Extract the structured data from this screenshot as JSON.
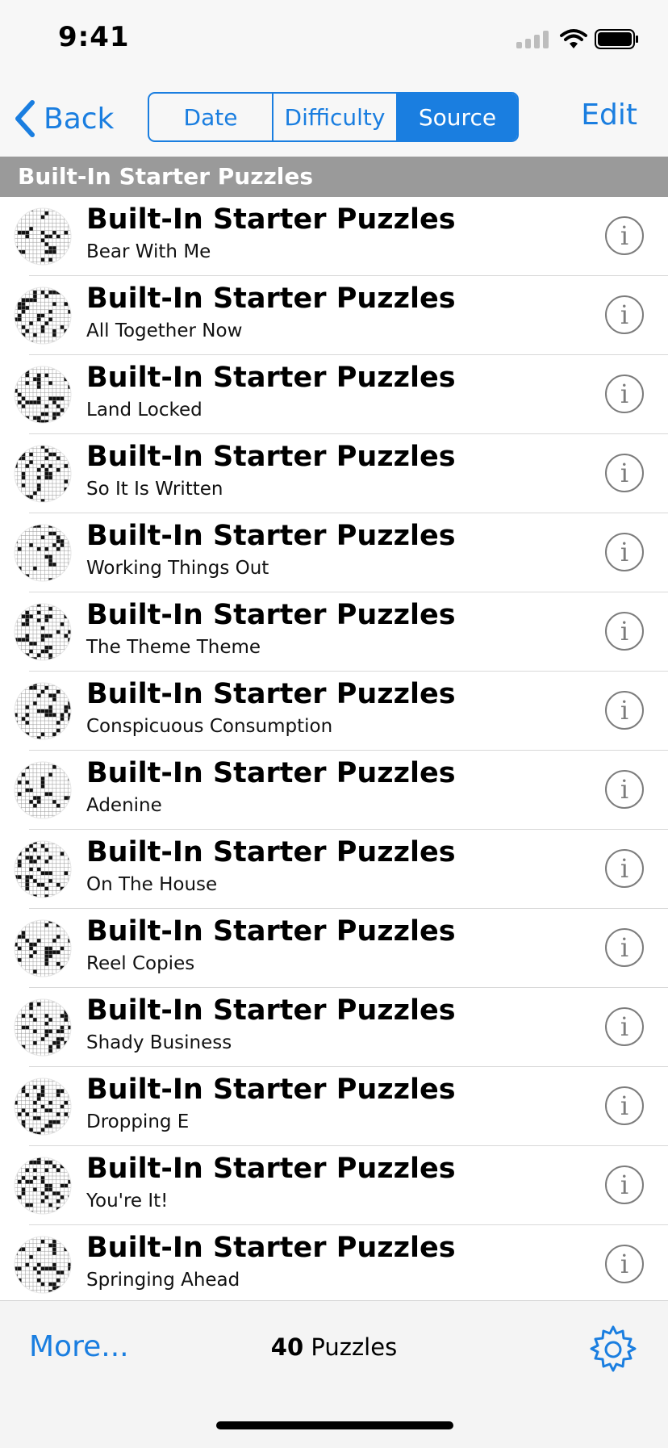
{
  "status_bar": {
    "time": "9:41"
  },
  "nav": {
    "back_label": "Back",
    "segments": [
      {
        "label": "Date",
        "selected": false
      },
      {
        "label": "Difficulty",
        "selected": false
      },
      {
        "label": "Source",
        "selected": true
      }
    ],
    "edit_label": "Edit"
  },
  "section": {
    "title": "Built-In Starter Puzzles"
  },
  "puzzles": [
    {
      "title": "Built-In Starter Puzzles",
      "subtitle": "Bear With Me"
    },
    {
      "title": "Built-In Starter Puzzles",
      "subtitle": "All Together Now"
    },
    {
      "title": "Built-In Starter Puzzles",
      "subtitle": "Land Locked"
    },
    {
      "title": "Built-In Starter Puzzles",
      "subtitle": "So It Is Written"
    },
    {
      "title": "Built-In Starter Puzzles",
      "subtitle": "Working Things Out"
    },
    {
      "title": "Built-In Starter Puzzles",
      "subtitle": "The Theme Theme"
    },
    {
      "title": "Built-In Starter Puzzles",
      "subtitle": "Conspicuous Consumption"
    },
    {
      "title": "Built-In Starter Puzzles",
      "subtitle": "Adenine"
    },
    {
      "title": "Built-In Starter Puzzles",
      "subtitle": "On The House"
    },
    {
      "title": "Built-In Starter Puzzles",
      "subtitle": "Reel Copies"
    },
    {
      "title": "Built-In Starter Puzzles",
      "subtitle": "Shady Business"
    },
    {
      "title": "Built-In Starter Puzzles",
      "subtitle": "Dropping E"
    },
    {
      "title": "Built-In Starter Puzzles",
      "subtitle": "You're It!"
    },
    {
      "title": "Built-In Starter Puzzles",
      "subtitle": "Springing Ahead"
    }
  ],
  "toolbar": {
    "more_label": "More...",
    "count": "40",
    "count_label": " Puzzles"
  },
  "colors": {
    "accent": "#1a7ee0",
    "section_bg": "#9a9a9a",
    "bar_bg": "#f7f7f7",
    "info_gray": "#7c7c7c"
  },
  "icons": {
    "back": "chevron-left-icon",
    "info": "info-icon",
    "settings": "gear-icon",
    "thumbnail": "crossword-grid-icon"
  }
}
